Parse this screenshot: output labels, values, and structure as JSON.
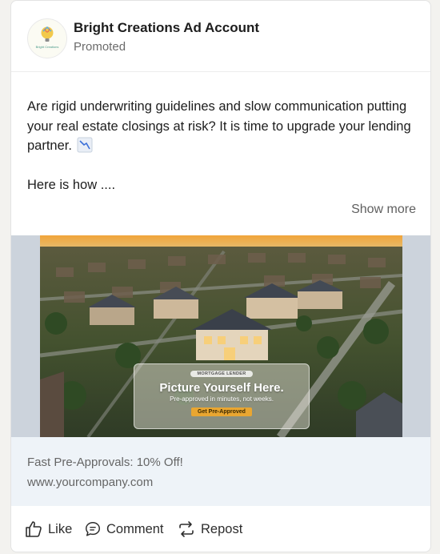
{
  "post": {
    "account_name": "Bright Creations Ad Account",
    "promoted_label": "Promoted",
    "logo_text": "Bright Creations",
    "body_paragraph_1": "Are rigid underwriting guidelines and slow communication putting your real estate closings at risk? It is time to upgrade your lending partner.",
    "body_paragraph_2": "Here is how ....",
    "show_more": "Show more"
  },
  "media": {
    "badge": "MORTGAGE LENDER",
    "title": "Picture Yourself Here.",
    "subtitle": "Pre-approved in minutes, not weeks.",
    "cta": "Get Pre-Approved"
  },
  "link": {
    "headline": "Fast Pre-Approvals: 10% Off!",
    "url": "www.yourcompany.com"
  },
  "actions": {
    "like": "Like",
    "comment": "Comment",
    "repost": "Repost"
  },
  "icons": {
    "emoji": "chart-decreasing-icon",
    "like": "thumbs-up-icon",
    "comment": "comment-icon",
    "repost": "repost-icon"
  }
}
